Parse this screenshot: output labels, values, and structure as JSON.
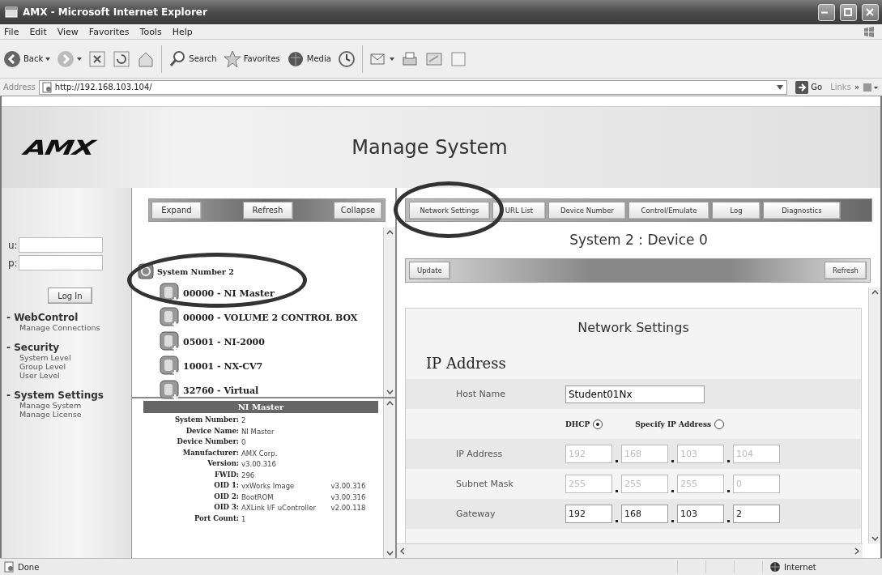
{
  "window": {
    "title": "AMX - Microsoft Internet Explorer"
  },
  "menu": [
    "File",
    "Edit",
    "View",
    "Favorites",
    "Tools",
    "Help"
  ],
  "toolbar": [
    {
      "kind": "back",
      "label": "Back"
    },
    {
      "kind": "forward"
    },
    {
      "kind": "stop"
    },
    {
      "kind": "refresh"
    },
    {
      "kind": "home"
    },
    {
      "kind": "search",
      "label": "Search"
    },
    {
      "kind": "favorites",
      "label": "Favorites"
    },
    {
      "kind": "media",
      "label": "Media"
    },
    {
      "kind": "history"
    },
    {
      "kind": "mail"
    },
    {
      "kind": "print"
    },
    {
      "kind": "edit"
    },
    {
      "kind": "discuss"
    }
  ],
  "address": {
    "label": "Address",
    "url": "http://192.168.103.104/",
    "go": "Go",
    "links": "Links",
    "chevron": "»"
  },
  "page": {
    "logo": "AMX",
    "title": "Manage System"
  },
  "login": {
    "user_label": "u:",
    "pass_label": "p:",
    "button": "Log In"
  },
  "nav": [
    {
      "heading": "- WebControl",
      "items": [
        "Manage Connections"
      ]
    },
    {
      "heading": "- Security",
      "items": [
        "System Level",
        "Group Level",
        "User Level"
      ]
    },
    {
      "heading": "- System Settings",
      "items": [
        "Manage System",
        "Manage License"
      ]
    }
  ],
  "tree": {
    "buttons": [
      "Expand",
      "Refresh",
      "Collapse"
    ],
    "root": {
      "label": "System Number 2",
      "children": [
        {
          "label": "00000 - NI Master"
        },
        {
          "label": "00000 - VOLUME 2 CONTROL BOX"
        },
        {
          "label": "05001 - NI-2000"
        },
        {
          "label": "10001 - NX-CV7"
        },
        {
          "label": "32760 - Virtual"
        }
      ]
    }
  },
  "details": {
    "title": "NI Master",
    "fields": [
      {
        "label": "System Number:",
        "value": "2"
      },
      {
        "label": "Device Name:",
        "value": "NI Master"
      },
      {
        "label": "Device Number:",
        "value": "0"
      },
      {
        "label": "Manufacturer:",
        "value": "AMX Corp."
      },
      {
        "label": "Version:",
        "value": "v3.00.316"
      },
      {
        "label": "FWID:",
        "value": "296"
      },
      {
        "label": "OID 1:",
        "value": "vxWorks Image",
        "version": "v3.00.316"
      },
      {
        "label": "OID 2:",
        "value": "BootROM",
        "version": "v3.00.316"
      },
      {
        "label": "OID 3:",
        "value": "AXLink I/F uController",
        "version": "v2.00.118"
      },
      {
        "label": "Port Count:",
        "value": "1"
      }
    ]
  },
  "tabs": [
    "Network Settings",
    "URL List",
    "Device Number",
    "Control/Emulate",
    "Log",
    "Diagnostics"
  ],
  "device_heading": "System 2 : Device 0",
  "actions": [
    "Update",
    "Refresh"
  ],
  "network": {
    "title": "Network Settings",
    "section": "IP Address",
    "host": {
      "label": "Host Name",
      "value": "Student01Nx"
    },
    "modes": [
      {
        "label": "DHCP",
        "selected": true
      },
      {
        "label": "Specify IP Address",
        "selected": false
      }
    ],
    "addresses": [
      {
        "label": "IP Address",
        "disabled": true,
        "octets": [
          "192",
          "168",
          "103",
          "104"
        ]
      },
      {
        "label": "Subnet Mask",
        "disabled": true,
        "octets": [
          "255",
          "255",
          "255",
          "0"
        ]
      },
      {
        "label": "Gateway",
        "disabled": false,
        "octets": [
          "192",
          "168",
          "103",
          "2"
        ]
      }
    ]
  },
  "annotations": [
    {
      "kind": "oval"
    },
    {
      "kind": "oval"
    }
  ],
  "status": {
    "text": "Done",
    "zone": "Internet"
  }
}
